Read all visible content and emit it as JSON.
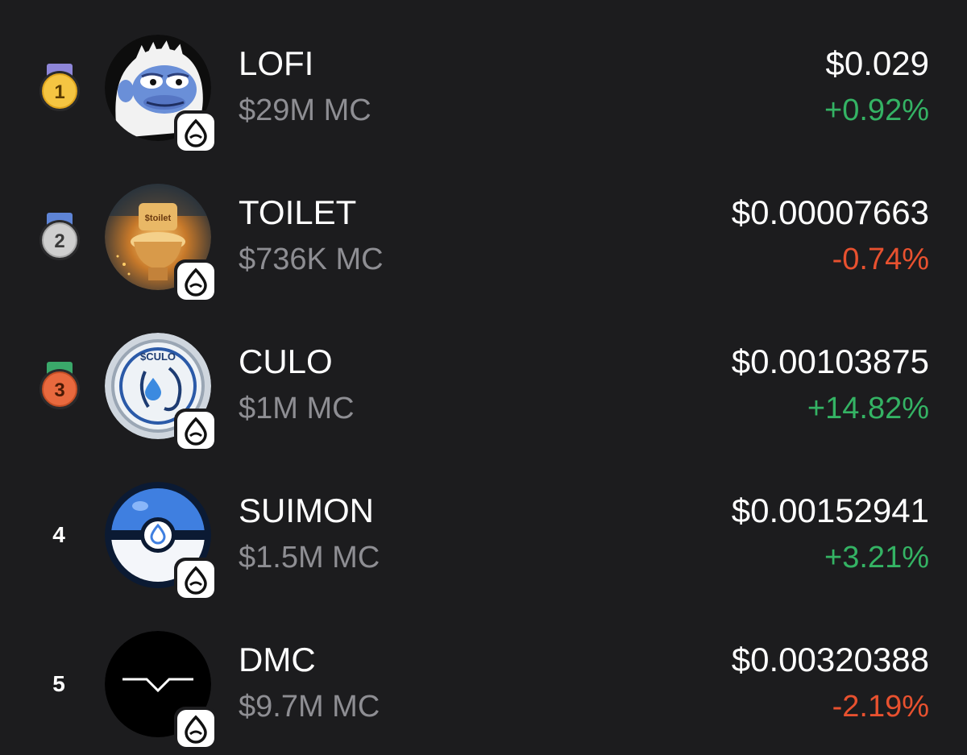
{
  "colors": {
    "background": "#1c1c1e",
    "positive": "#34b364",
    "negative": "#e8512f",
    "secondary_text": "#8e8e93",
    "gold_medal": "#f5c542",
    "silver_medal": "#cfcfcf",
    "bronze_medal": "#e8693e"
  },
  "tokens": [
    {
      "rank": "1",
      "rank_style": "gold-medal",
      "name": "LOFI",
      "market_cap": "$29M MC",
      "price": "$0.029",
      "change": "+0.92%",
      "direction": "up",
      "avatar_icon": "lofi-yeti-avatar",
      "chain_icon": "sui-droplet-icon"
    },
    {
      "rank": "2",
      "rank_style": "silver-medal",
      "name": "TOILET",
      "market_cap": "$736K MC",
      "price": "$0.00007663",
      "change": "-0.74%",
      "direction": "down",
      "avatar_icon": "toilet-avatar",
      "avatar_text": "$toilet",
      "chain_icon": "sui-droplet-icon"
    },
    {
      "rank": "3",
      "rank_style": "bronze-medal",
      "name": "CULO",
      "market_cap": "$1M MC",
      "price": "$0.00103875",
      "change": "+14.82%",
      "direction": "up",
      "avatar_icon": "culo-coin-avatar",
      "avatar_text": "$CULO",
      "chain_icon": "sui-droplet-icon"
    },
    {
      "rank": "4",
      "rank_style": "plain",
      "name": "SUIMON",
      "market_cap": "$1.5M MC",
      "price": "$0.00152941",
      "change": "+3.21%",
      "direction": "up",
      "avatar_icon": "suimon-ball-avatar",
      "chain_icon": "sui-droplet-icon"
    },
    {
      "rank": "5",
      "rank_style": "plain",
      "name": "DMC",
      "market_cap": "$9.7M MC",
      "price": "$0.00320388",
      "change": "-2.19%",
      "direction": "down",
      "avatar_icon": "dmc-wave-avatar",
      "chain_icon": "sui-droplet-icon"
    }
  ]
}
